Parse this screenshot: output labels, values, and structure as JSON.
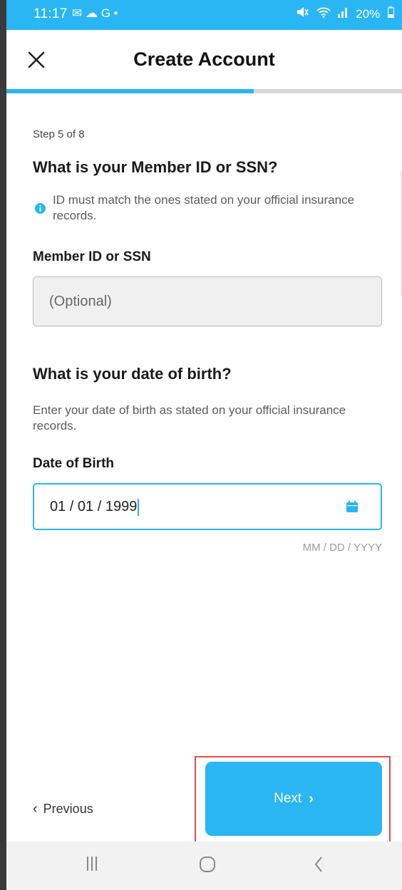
{
  "status_bar": {
    "time": "11:17",
    "left_icons": "✉ ☁ G •",
    "right_icons": [
      "mute-icon",
      "wifi-icon",
      "signal-icon"
    ],
    "battery": "20%"
  },
  "header": {
    "title": "Create Account",
    "close_icon": "close-icon"
  },
  "progress": {
    "current_step": 5,
    "total_steps": 8,
    "fraction": 0.625
  },
  "form": {
    "step_text": "Step 5 of 8",
    "member_question": "What is your Member ID or SSN?",
    "member_info": "ID must match the ones stated on your official insurance records.",
    "member_label": "Member ID or SSN",
    "member_placeholder": "(Optional)",
    "member_value": "",
    "dob_question": "What is your date of birth?",
    "dob_help": "Enter your date of birth as stated on your official insurance records.",
    "dob_label": "Date of Birth",
    "dob_value": "01 / 01 / 1999",
    "dob_format": "MM / DD / YYYY"
  },
  "actions": {
    "previous_label": "Previous",
    "next_label": "Next"
  },
  "nav_bar": {
    "recent": "|||",
    "home": "○",
    "back": "<"
  },
  "colors": {
    "accent": "#29b6f2",
    "highlight": "#e24b4b",
    "input_bg": "#f0f0f0"
  }
}
